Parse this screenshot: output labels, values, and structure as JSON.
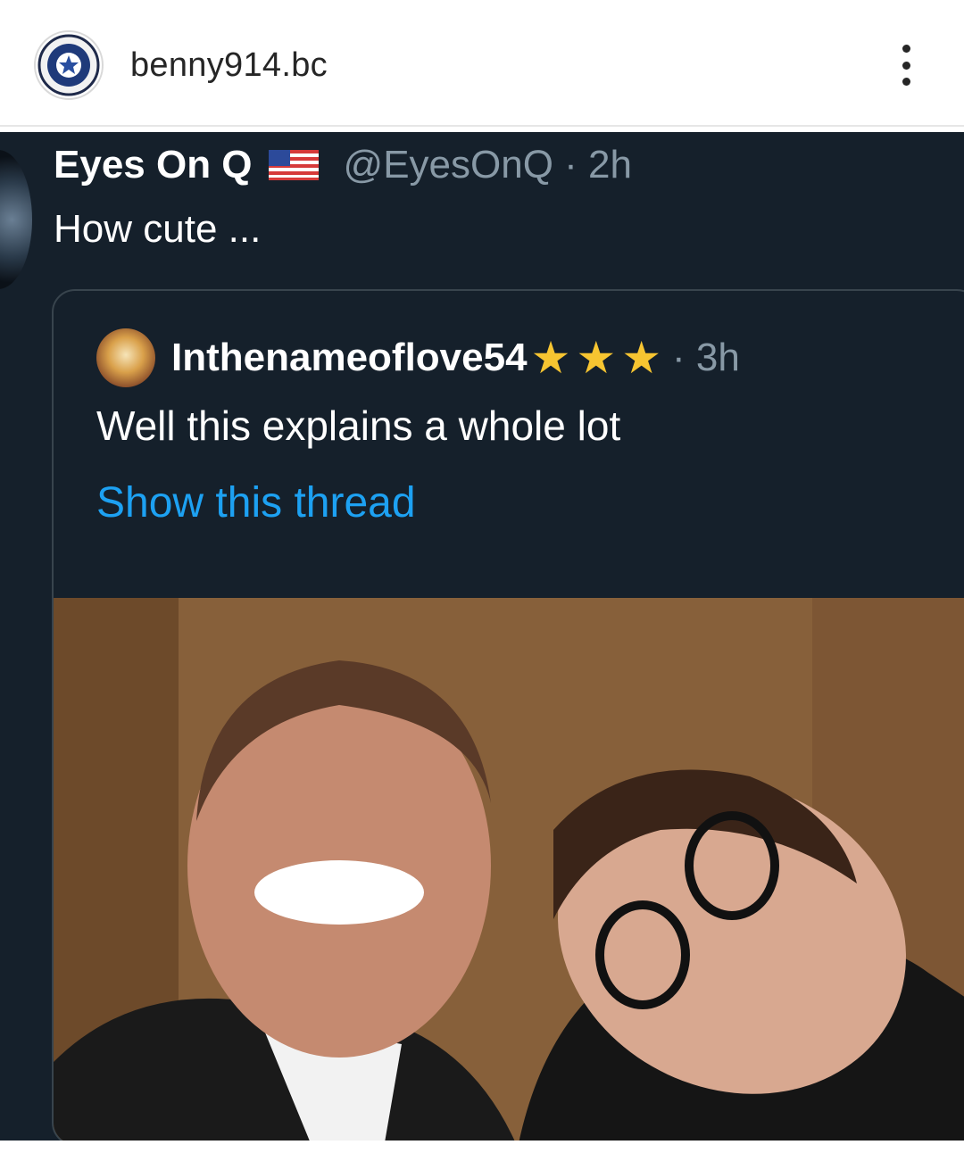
{
  "ig_header": {
    "username": "benny914.bc",
    "avatar_icon": "emblem-seal-icon",
    "more_icon": "more-vertical-icon"
  },
  "tweet": {
    "author_name": "Eyes On Q",
    "flag_icon": "us-flag-icon",
    "handle_time": "@EyesOnQ · 2h",
    "text": "How cute ...",
    "quote": {
      "author_name": "Inthenameoflove54",
      "star_icons": [
        "star-icon",
        "star-icon",
        "star-icon"
      ],
      "time": "· 3h",
      "text": "Well this explains a whole lot",
      "show_thread": "Show this thread"
    }
  },
  "colors": {
    "tweet_background": "#15202b",
    "link_blue": "#1da1f2",
    "meta_gray": "#8899a6",
    "star_yellow": "#f7c531"
  }
}
